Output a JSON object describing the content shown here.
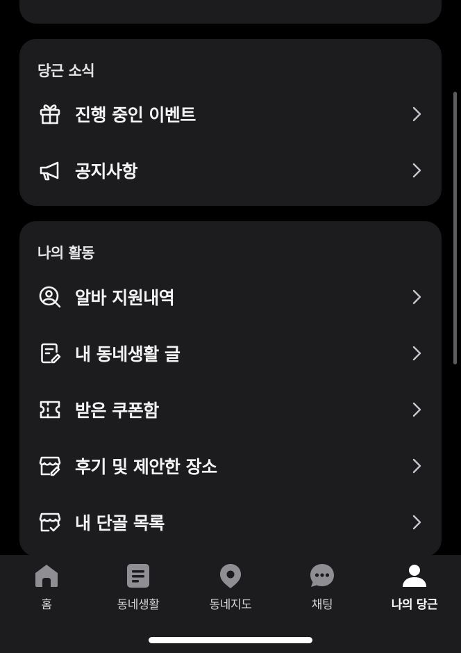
{
  "news_section": {
    "title": "당근 소식",
    "items": [
      {
        "label": "진행 중인 이벤트",
        "icon": "gift-icon"
      },
      {
        "label": "공지사항",
        "icon": "megaphone-icon"
      }
    ]
  },
  "activity_section": {
    "title": "나의 활동",
    "items": [
      {
        "label": "알바 지원내역",
        "icon": "job-search-icon"
      },
      {
        "label": "내 동네생활 글",
        "icon": "document-edit-icon"
      },
      {
        "label": "받은 쿠폰함",
        "icon": "coupon-icon"
      },
      {
        "label": "후기 및 제안한 장소",
        "icon": "store-edit-icon"
      },
      {
        "label": "내 단골 목록",
        "icon": "store-check-icon"
      }
    ]
  },
  "tab_bar": {
    "active_tab": "나의 당근",
    "tabs": [
      {
        "label": "홈",
        "icon": "home-icon"
      },
      {
        "label": "동네생활",
        "icon": "community-icon"
      },
      {
        "label": "동네지도",
        "icon": "map-pin-icon"
      },
      {
        "label": "채팅",
        "icon": "chat-icon"
      },
      {
        "label": "나의 당근",
        "icon": "profile-icon"
      }
    ]
  },
  "colors": {
    "background": "#000000",
    "card": "#1c1c1f",
    "text_primary": "#f4f4f5",
    "tab_inactive_icon": "#8e8e93",
    "tab_active_icon": "#ffffff"
  }
}
